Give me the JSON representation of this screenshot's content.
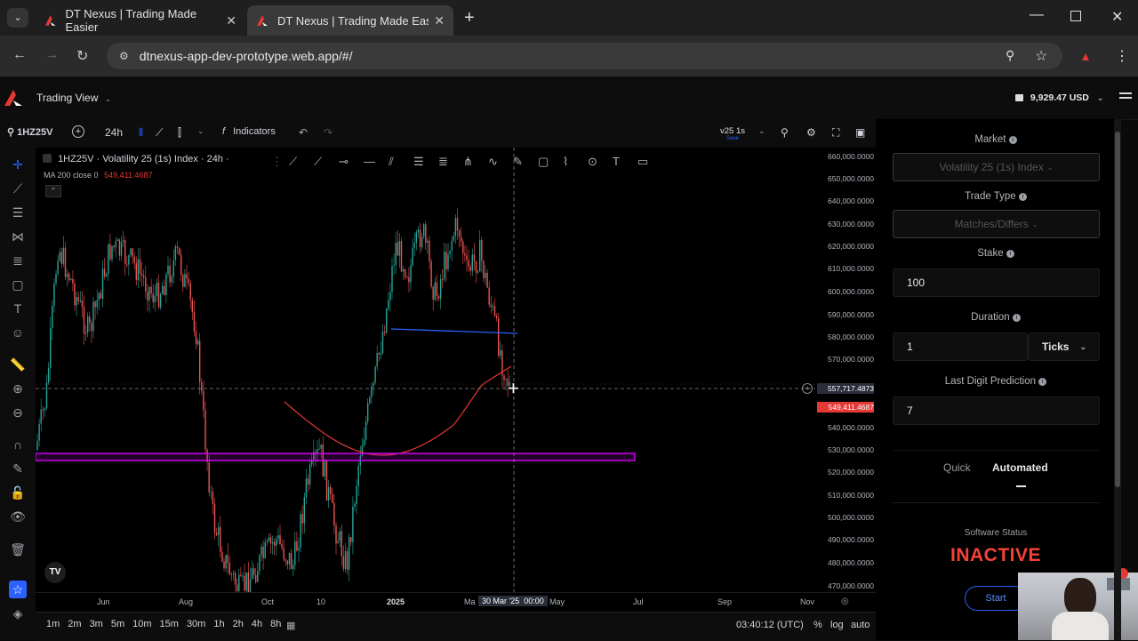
{
  "browser": {
    "tabs": [
      {
        "title": "DT Nexus | Trading Made Easier",
        "active": false
      },
      {
        "title": "DT Nexus | Trading Made Easier",
        "active": true
      }
    ],
    "url": "dtnexus-app-dev-prototype.web.app/#/"
  },
  "app": {
    "view_label": "Trading View",
    "balance": "9,929.47 USD"
  },
  "toolbar": {
    "symbol": "1HZ25V",
    "interval": "24h",
    "indicators_label": "Indicators",
    "layout_name": "v25 1s",
    "save_label": "Save"
  },
  "chart": {
    "legend_title": "1HZ25V · Volatility 25 (1s) Index · 24h ·",
    "ma_label": "MA 200 close 0",
    "ma_value": "549,411.4687",
    "price_ticks": [
      "660,000.0000",
      "650,000.0000",
      "640,000.0000",
      "630,000.0000",
      "620,000.0000",
      "610,000.0000",
      "600,000.0000",
      "590,000.0000",
      "580,000.0000",
      "570,000.0000",
      "557,717.4873",
      "549,411.4687",
      "540,000.0000",
      "530,000.0000",
      "520,000.0000",
      "510,000.0000",
      "500,000.0000",
      "490,000.0000",
      "480,000.0000",
      "470,000.0000"
    ],
    "crosshair_price": "557,717.4873",
    "ma_price": "549,411.4687",
    "time_ticks": [
      "Jun",
      "Aug",
      "Oct",
      "10",
      "2025",
      "Ma",
      "May",
      "Jul",
      "Sep",
      "Nov"
    ],
    "crosshair_time": "30 Mar '25  00:00",
    "colors": {
      "up": "#26a69a",
      "down": "#ef5350",
      "ma": "#e53935",
      "trend": "#2962ff",
      "zone": "#d500f9"
    }
  },
  "bottombar": {
    "timeframes": [
      "1m",
      "2m",
      "3m",
      "5m",
      "10m",
      "15m",
      "30m",
      "1h",
      "2h",
      "4h",
      "8h"
    ],
    "clock": "03:40:12 (UTC)",
    "percent": "%",
    "log": "log",
    "auto": "auto"
  },
  "panel": {
    "market_label": "Market",
    "market_value": "Volatility 25 (1s) Index",
    "trade_type_label": "Trade Type",
    "trade_type_value": "Matches/Differs",
    "stake_label": "Stake",
    "stake_value": "100",
    "duration_label": "Duration",
    "duration_value": "1",
    "duration_unit": "Ticks",
    "last_digit_label": "Last Digit Prediction",
    "last_digit_value": "7",
    "mode_quick": "Quick",
    "mode_automated": "Automated",
    "status_label": "Software Status",
    "status_value": "INACTIVE",
    "start_label": "Start"
  }
}
